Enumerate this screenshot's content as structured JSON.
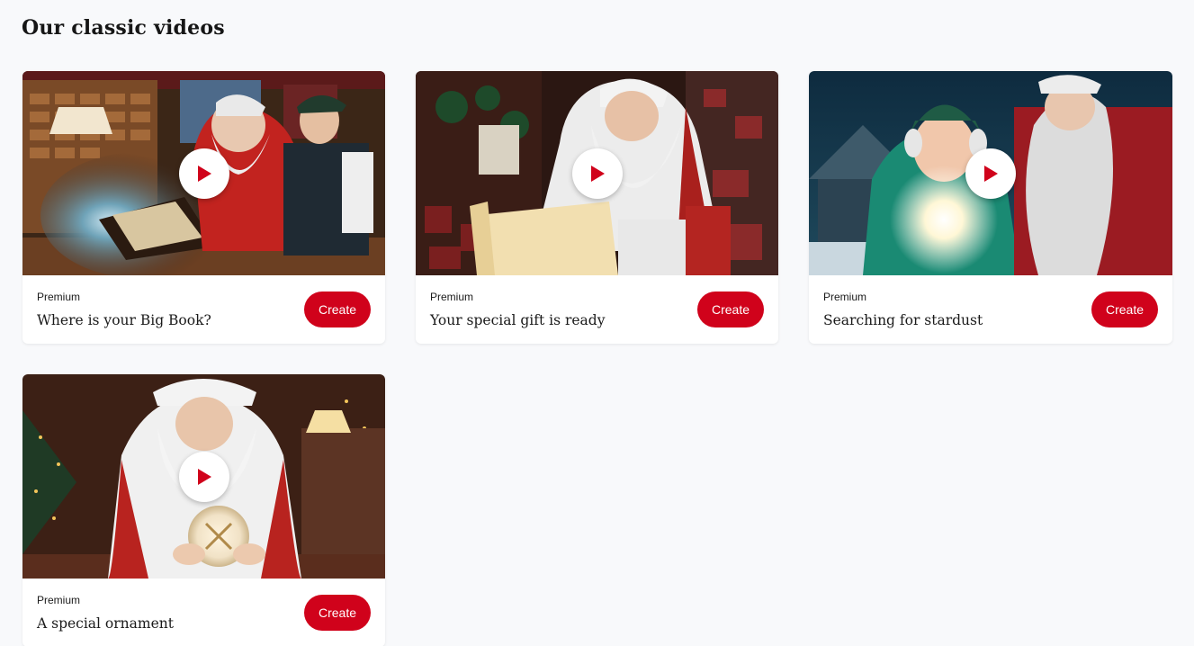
{
  "section": {
    "title": "Our classic videos"
  },
  "colors": {
    "accent": "#d0021b",
    "background": "#f8f9fb",
    "card": "#ffffff"
  },
  "videos": [
    {
      "tier": "Premium",
      "title": "Where is your Big Book?",
      "action": "Create",
      "icon": "play-icon"
    },
    {
      "tier": "Premium",
      "title": "Your special gift is ready",
      "action": "Create",
      "icon": "play-icon"
    },
    {
      "tier": "Premium",
      "title": "Searching for stardust",
      "action": "Create",
      "icon": "play-icon"
    },
    {
      "tier": "Premium",
      "title": "A special ornament",
      "action": "Create",
      "icon": "play-icon"
    }
  ]
}
